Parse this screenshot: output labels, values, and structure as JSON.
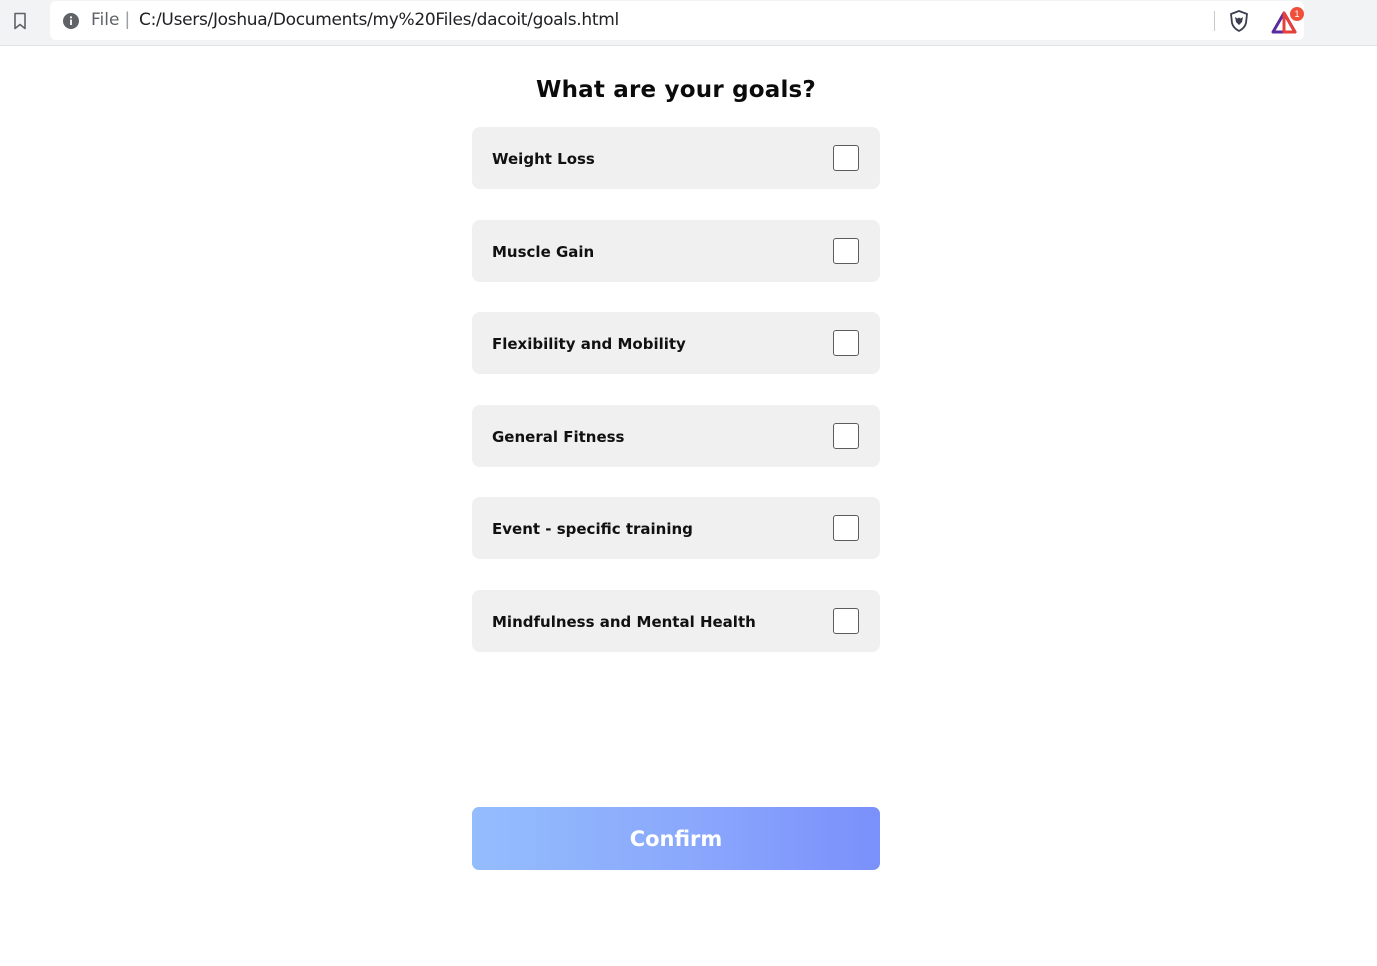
{
  "browser": {
    "scheme_label": "File",
    "separator": "|",
    "url": "C:/Users/Joshua/Documents/my%20Files/dacoit/goals.html",
    "rewards_badge": "1",
    "icons": [
      "bookmark-icon",
      "info-icon",
      "brave-shield-icon",
      "brave-rewards-icon"
    ]
  },
  "page": {
    "title": "What are your goals?",
    "goals": [
      {
        "label": "Weight Loss",
        "checked": false
      },
      {
        "label": "Muscle Gain",
        "checked": false
      },
      {
        "label": "Flexibility and Mobility",
        "checked": false
      },
      {
        "label": "General Fitness",
        "checked": false
      },
      {
        "label": "Event - specific training",
        "checked": false
      },
      {
        "label": "Mindfulness and Mental Health",
        "checked": false
      }
    ],
    "confirm_label": "Confirm"
  },
  "colors": {
    "card_background": "#f0f0f0",
    "button_gradient_start": "#94bdfd",
    "button_gradient_end": "#7a90fb",
    "rewards_badge": "#f0503a"
  }
}
